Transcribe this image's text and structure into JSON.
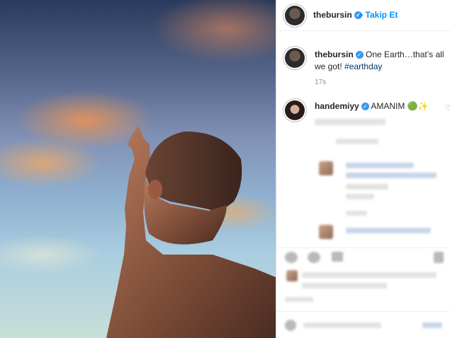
{
  "post": {
    "author": "thebursin",
    "follow_label": "Takip Et",
    "caption_user": "thebursin",
    "caption_text": "One Earth…that’s all we got!",
    "caption_hashtag": "#earthday",
    "time": "17s"
  },
  "comments": [
    {
      "user": "handemiyy",
      "text": "AMANIM",
      "emoji": "🟢✨"
    }
  ],
  "icons": {
    "verified": "verified-badge-icon",
    "heart": "heart-icon"
  },
  "colors": {
    "link": "#0095f6",
    "verified": "#3897f0",
    "hashtag": "#00376b"
  }
}
